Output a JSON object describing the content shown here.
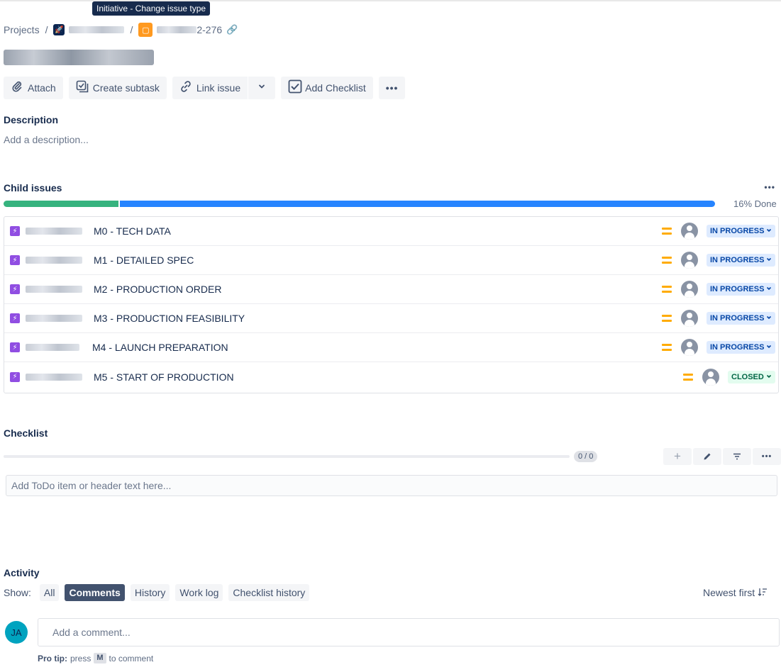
{
  "tooltip": "Initiative - Change issue type",
  "breadcrumb": {
    "projects": "Projects",
    "sep": "/",
    "issue_key_suffix": "2-276"
  },
  "toolbar": {
    "attach": "Attach",
    "create_subtask": "Create subtask",
    "link_issue": "Link issue",
    "add_checklist": "Add Checklist"
  },
  "description": {
    "label": "Description",
    "placeholder": "Add a description..."
  },
  "child_issues": {
    "label": "Child issues",
    "done_fraction": 0.16,
    "done_text": "16% Done",
    "rows": [
      {
        "summary": "M0 - TECH DATA",
        "priority": "medium",
        "status": "IN PROGRESS",
        "status_type": "in-progress"
      },
      {
        "summary": "M1 - DETAILED SPEC",
        "priority": "medium",
        "status": "IN PROGRESS",
        "status_type": "in-progress"
      },
      {
        "summary": "M2 - PRODUCTION ORDER",
        "priority": "medium",
        "status": "IN PROGRESS",
        "status_type": "in-progress"
      },
      {
        "summary": "M3 - PRODUCTION FEASIBILITY",
        "priority": "medium",
        "status": "IN PROGRESS",
        "status_type": "in-progress"
      },
      {
        "summary": "M4 - LAUNCH PREPARATION",
        "priority": "medium",
        "status": "IN PROGRESS",
        "status_type": "in-progress"
      },
      {
        "summary": "M5 - START OF PRODUCTION",
        "priority": "medium",
        "status": "CLOSED",
        "status_type": "closed"
      }
    ]
  },
  "checklist": {
    "label": "Checklist",
    "count": "0 / 0",
    "todo_placeholder": "Add ToDo item or header text here..."
  },
  "activity": {
    "label": "Activity",
    "show_label": "Show:",
    "filters": [
      "All",
      "Comments",
      "History",
      "Work log",
      "Checklist history"
    ],
    "active_filter": "Comments",
    "sort_label": "Newest first",
    "avatar_initials": "JA",
    "comment_placeholder": "Add a comment...",
    "protip_prefix": "Pro tip:",
    "protip_press": "press",
    "protip_key": "M",
    "protip_suffix": "to comment"
  },
  "colors": {
    "progress_done": "#36b37e",
    "progress_inprogress": "#2684ff",
    "epic_icon": "#904ee2",
    "priority_medium": "#ffab00",
    "status_inprogress_bg": "#deebff",
    "status_closed_bg": "#e3fcef",
    "avatar_ja": "#00a3bf"
  }
}
